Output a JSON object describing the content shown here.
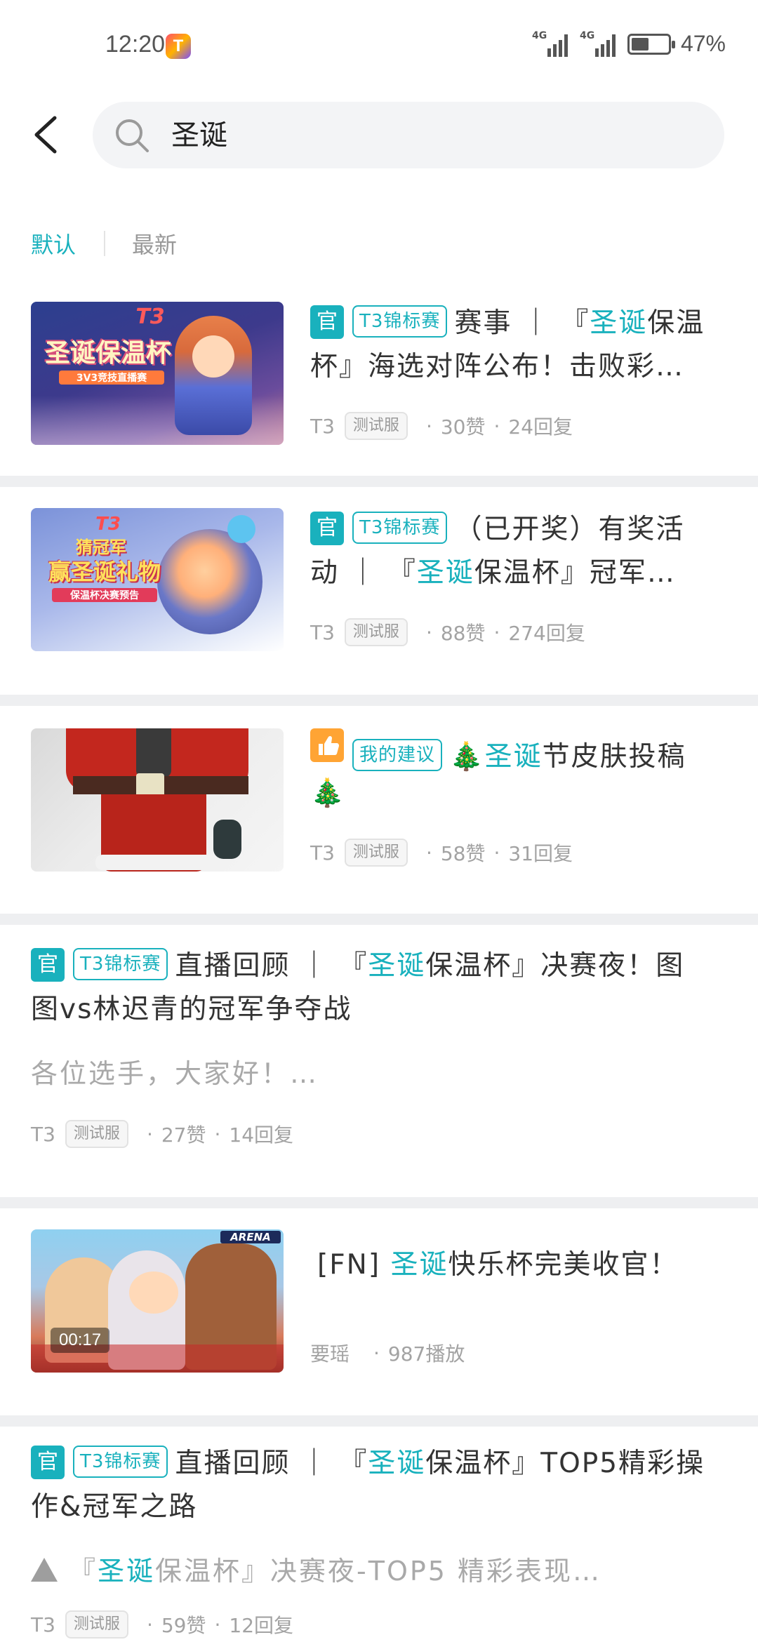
{
  "status_bar": {
    "time": "12:20",
    "network_1": "4G",
    "network_2": "4G",
    "battery_pct": "47%",
    "battery_level": 0.47
  },
  "header": {
    "search_query": "圣诞"
  },
  "sort_tabs": {
    "default": "默认",
    "latest": "最新"
  },
  "posts": [
    {
      "badge": "官",
      "tag": "T3锦标赛",
      "title_line1_pre": "赛事 ｜ 『",
      "title_line1_hl": "圣诞",
      "title_line1_post": "保温",
      "title_line2": "杯』海选对阵公布！击败彩…",
      "thumb_brand": "T3",
      "thumb_title": "圣诞保温杯",
      "thumb_sub": "3V3竞技直播赛",
      "author": "T3",
      "server": "测试服",
      "likes": "30赞",
      "replies": "24回复"
    },
    {
      "badge": "官",
      "tag": "T3锦标赛",
      "title_line1": "（已开奖）有奖活",
      "title_line2_pre": "动 ｜ 『",
      "title_line2_hl": "圣诞",
      "title_line2_post": "保温杯』冠军…",
      "thumb_brand": "T3",
      "thumb_title": "猜冠军",
      "thumb_title2": "赢圣诞礼物",
      "thumb_sub": "保温杯决赛预告",
      "author": "T3",
      "server": "测试服",
      "likes": "88赞",
      "replies": "274回复"
    },
    {
      "tag": "我的建议",
      "tree": "🎄",
      "title_hl": "圣诞",
      "title_post": "节皮肤投稿",
      "author": "T3",
      "server": "测试服",
      "likes": "58赞",
      "replies": "31回复"
    },
    {
      "badge": "官",
      "tag": "T3锦标赛",
      "title_line1_pre": "直播回顾 ｜ 『",
      "title_line1_hl": "圣诞",
      "title_line1_post": "保温杯』决赛夜！图",
      "title_line2": "图vs林迟青的冠军争夺战",
      "excerpt": "各位选手，大家好！…",
      "author": "T3",
      "server": "测试服",
      "likes": "27赞",
      "replies": "14回复"
    },
    {
      "title_pre": "[FN] ",
      "title_hl": "圣诞",
      "title_post": "快乐杯完美收官！",
      "thumb_label": "ARENA",
      "duration": "00:17",
      "author": "要瑶",
      "plays": "987播放"
    },
    {
      "badge": "官",
      "tag": "T3锦标赛",
      "title_line1_pre": "直播回顾 ｜ 『",
      "title_line1_hl": "圣诞",
      "title_line1_post": "保温杯』TOP5精彩操",
      "title_line2": "作&冠军之路",
      "excerpt_pre": "『",
      "excerpt_hl": "圣诞",
      "excerpt_post": "保温杯』决赛夜-TOP5 精彩表现…",
      "author": "T3",
      "server": "测试服",
      "likes": "59赞",
      "replies": "12回复"
    }
  ],
  "colors": {
    "accent": "#19b1bd",
    "suggestion_badge": "#ffa434",
    "meta_text": "#a3a3a3",
    "separator": "#eeeff1"
  }
}
